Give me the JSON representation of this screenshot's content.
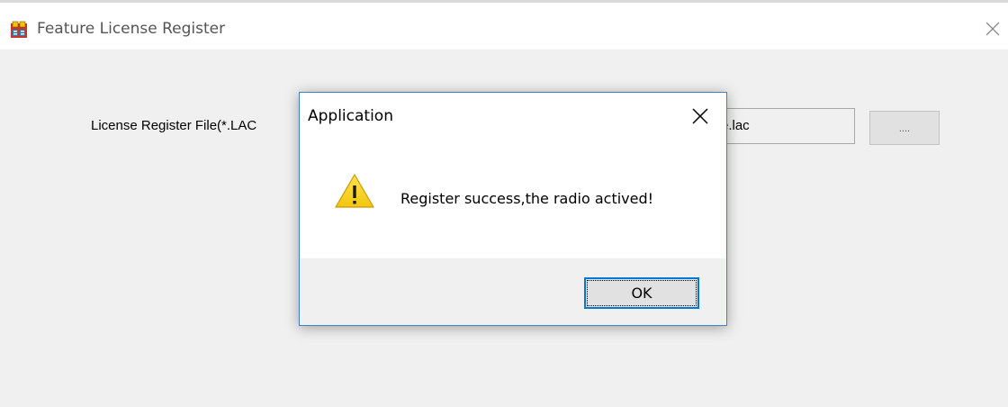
{
  "main_window": {
    "title": "Feature License Register",
    "app_icon": "app-logo-icon",
    "close_icon": "close-icon"
  },
  "form": {
    "file_label": "License Register File(*.LAC",
    "file_value": "e.lac",
    "browse_label": "...."
  },
  "dialog": {
    "title": "Application",
    "close_icon": "close-icon",
    "icon": "warning-icon",
    "message": "Register success,the radio actived!",
    "ok_label": "OK"
  },
  "colors": {
    "accent": "#0078d7",
    "dialog_border": "#3b84c9",
    "warning_yellow": "#f9d71c",
    "background": "#f0f0f0"
  }
}
